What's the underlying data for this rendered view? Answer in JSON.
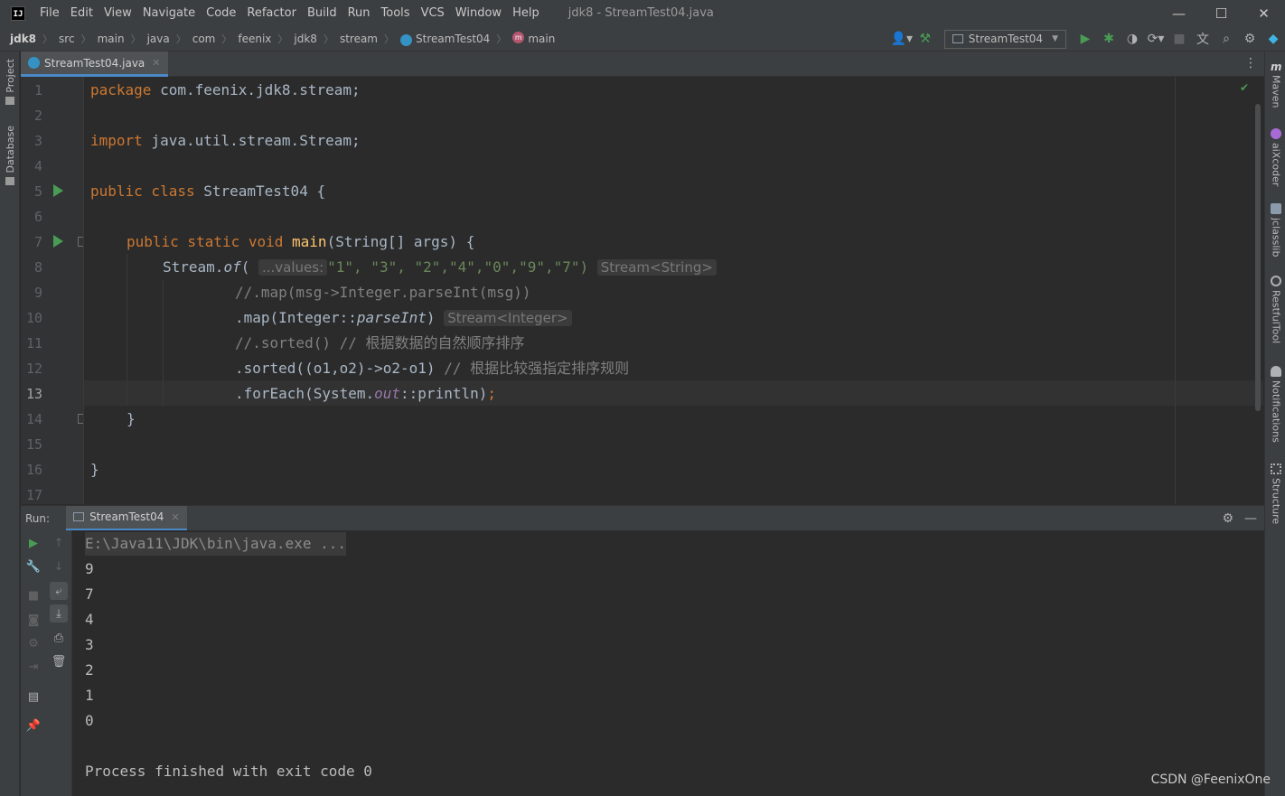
{
  "app": {
    "logo_text": "IJ",
    "window_title": "jdk8 - StreamTest04.java"
  },
  "menu": [
    "File",
    "Edit",
    "View",
    "Navigate",
    "Code",
    "Refactor",
    "Build",
    "Run",
    "Tools",
    "VCS",
    "Window",
    "Help"
  ],
  "window_controls": {
    "minimize": "—",
    "maximize": "☐",
    "close": "✕"
  },
  "breadcrumb": [
    "jdk8",
    "src",
    "main",
    "java",
    "com",
    "feenix",
    "jdk8",
    "stream",
    "StreamTest04",
    "main"
  ],
  "method_icon_letter": "m",
  "run_config": "StreamTest04",
  "left_tabs": [
    "Project",
    "Database"
  ],
  "right_tabs": [
    "Maven",
    "aiXcoder",
    "jclasslib",
    "RestfulTool",
    "Notifications",
    "Structure"
  ],
  "editor_tab": {
    "filename": "StreamTest04.java"
  },
  "editor": {
    "current_line": 13,
    "line_numbers": [
      "1",
      "2",
      "3",
      "4",
      "5",
      "6",
      "7",
      "8",
      "9",
      "10",
      "11",
      "12",
      "13",
      "14",
      "15",
      "16",
      "17"
    ],
    "line1": {
      "kw": "package",
      "rest": " com.feenix.jdk8.stream;"
    },
    "line3": {
      "kw": "import",
      "rest": " java.util.stream.Stream;"
    },
    "line5": {
      "kw": "public class",
      "name": " StreamTest04 {"
    },
    "line7": {
      "kw": "public static void",
      "fn": "main",
      "rest": "(String[] args) {"
    },
    "line8": {
      "prefix": "Stream.",
      "method": "of",
      "paren": "(",
      "hint": "...values:",
      "args": "\"1\", \"3\", \"2\",\"4\",\"0\",\"9\",\"7\")",
      "type_hint": "Stream<String>"
    },
    "line9": {
      "comment": "//.map(msg->Integer.parseInt(msg))"
    },
    "line10": {
      "prefix": ".map(Integer::",
      "method": "parseInt",
      "suffix": ")",
      "type_hint": "Stream<Integer>"
    },
    "line11": {
      "comment": "//.sorted() // 根据数据的自然顺序排序"
    },
    "line12": {
      "code": ".sorted((o1,o2)->o2-o1)",
      "comment": " // 根据比较强指定排序规则"
    },
    "line13": {
      "prefix": ".forEach(System.",
      "field": "out",
      "suffix": "::println)",
      "semi": ";"
    },
    "line14": "}",
    "line16": "}"
  },
  "run_panel": {
    "label": "Run:",
    "tab": "StreamTest04",
    "command": "E:\\Java11\\JDK\\bin\\java.exe ...",
    "output": [
      "9",
      "7",
      "4",
      "3",
      "2",
      "1",
      "0"
    ],
    "exit": "Process finished with exit code 0"
  },
  "watermark": "CSDN @FeenixOne",
  "colors": {
    "keyword": "#cc7832",
    "string": "#6a8759",
    "function": "#ffc66d",
    "comment": "#808080",
    "run": "#499c54",
    "accent": "#4a88c7"
  }
}
